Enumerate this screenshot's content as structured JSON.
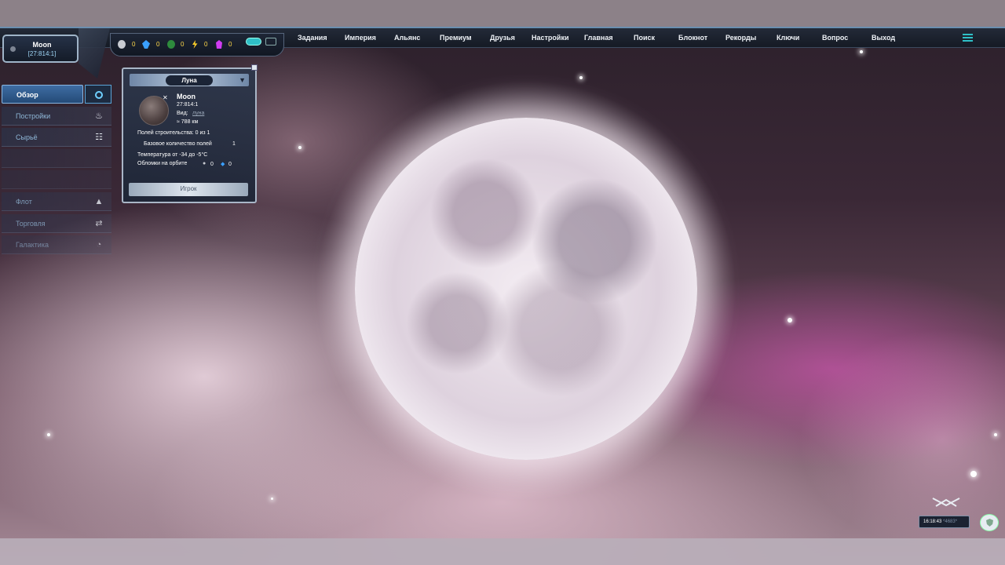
{
  "nav": {
    "items": [
      "Задания",
      "Империя",
      "Альянс",
      "Премиум",
      "Друзья",
      "Настройки",
      "Главная",
      "Поиск",
      "Блокнот",
      "Рекорды",
      "Ключи",
      "Вопрос",
      "Выход"
    ]
  },
  "planet": {
    "name": "Moon",
    "coords": "[27:814:1]"
  },
  "resources": [
    {
      "icon": "metal-icon",
      "value": "0",
      "color": "#c9ccd2"
    },
    {
      "icon": "crystal-icon",
      "value": "0",
      "color": "#3aa0ff"
    },
    {
      "icon": "deuterium-icon",
      "value": "0",
      "color": "#2e8b3d"
    },
    {
      "icon": "energy-icon",
      "value": "0",
      "color": "#ffcf2a"
    },
    {
      "icon": "darkmatter-icon",
      "value": "0",
      "color": "#d03cf2"
    }
  ],
  "sidebar": {
    "items": [
      {
        "label": "Обзор",
        "icon": "planet-icon"
      },
      {
        "label": "Постройки",
        "icon": "fire-icon"
      },
      {
        "label": "Сырьё",
        "icon": "ladder-icon"
      },
      {
        "label": "",
        "icon": ""
      },
      {
        "label": "",
        "icon": ""
      },
      {
        "label": "Флот",
        "icon": "ship-icon"
      },
      {
        "label": "Торговля",
        "icon": "swap-icon"
      },
      {
        "label": "Галактика",
        "icon": "galaxy-icon"
      }
    ]
  },
  "panel": {
    "title": "Луна",
    "name": "Moon",
    "coords": "27:814:1",
    "view_label": "Вид:",
    "view_value": "луна",
    "diameter": "≈ 788 км",
    "fields": "Полей строительства: 0 из 1",
    "base_fields_label": "Базовое количество полей",
    "base_fields_value": "1",
    "temperature": "Температура от -34 до -5°C",
    "debris_label": "Обломки на орбите",
    "debris_metal": "0",
    "debris_crystal": "0",
    "footer": "Игрок"
  },
  "clock": {
    "time": "16:18:43",
    "ms": "*4683*"
  },
  "colors": {
    "accent": "#2fc0c7",
    "nav_bg": "#151a24",
    "resource_text": "#ffd84a"
  }
}
